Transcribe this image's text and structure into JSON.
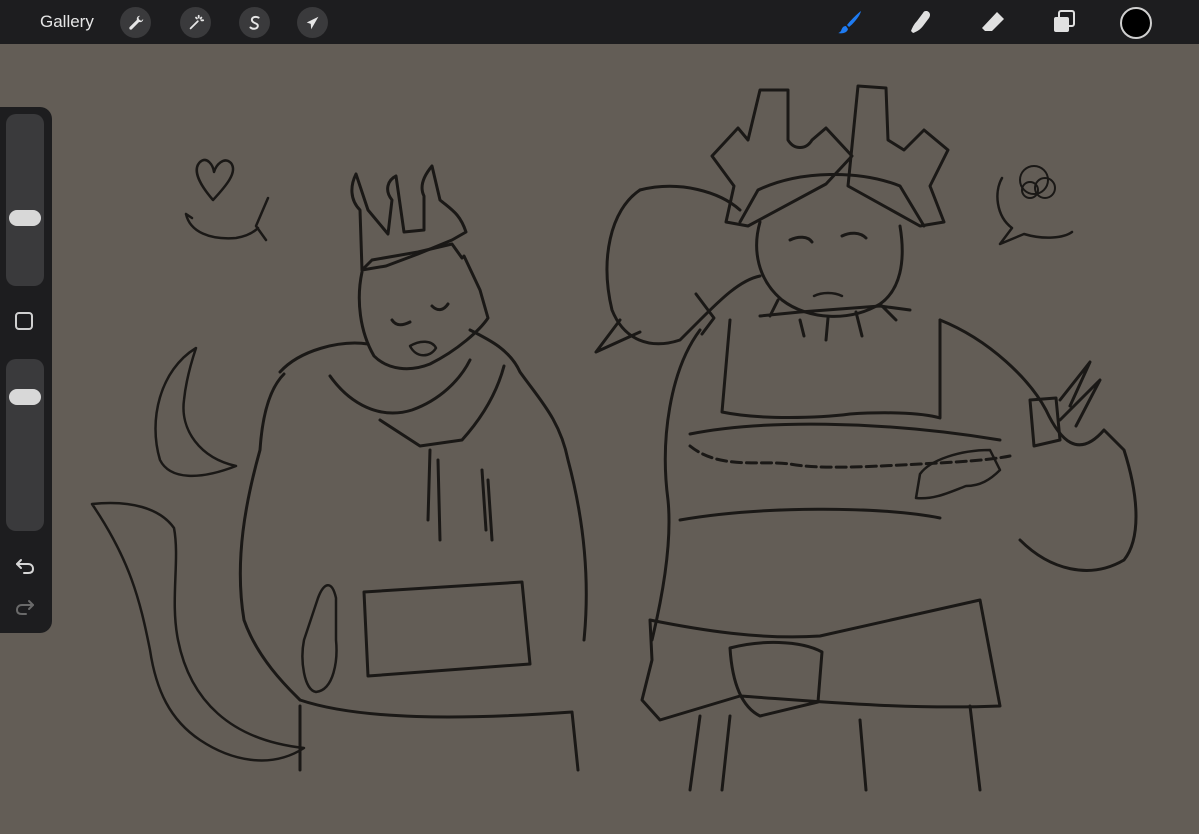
{
  "topbar": {
    "gallery_label": "Gallery",
    "left_tools": [
      {
        "name": "actions",
        "icon": "wrench-icon"
      },
      {
        "name": "adjustments",
        "icon": "magic-wand-icon"
      },
      {
        "name": "selection",
        "icon": "selection-s-icon"
      },
      {
        "name": "transform",
        "icon": "arrow-cursor-icon"
      }
    ],
    "right_tools": [
      {
        "name": "brush",
        "icon": "brush-icon",
        "active": true
      },
      {
        "name": "smudge",
        "icon": "smudge-finger-icon"
      },
      {
        "name": "eraser",
        "icon": "eraser-icon"
      },
      {
        "name": "layers",
        "icon": "layers-icon"
      }
    ],
    "current_color": "#000000"
  },
  "sidebar": {
    "brush_size_level": 0.62,
    "opacity_level": 0.77,
    "undo_icon": "undo-arrow-icon",
    "redo_icon": "redo-arrow-icon"
  },
  "canvas": {
    "background_color": "#635d56",
    "content": "pencil-sketch-two-characters"
  },
  "colors": {
    "accent": "#1e7bf2",
    "toolbar_bg": "#1d1d1f",
    "icon": "#e0e0e0"
  }
}
